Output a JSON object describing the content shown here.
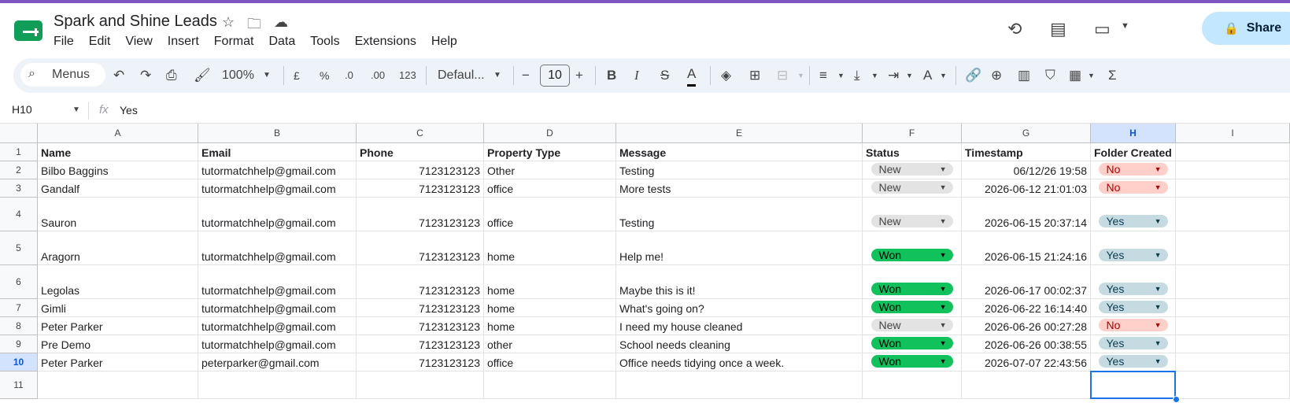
{
  "header": {
    "title": "Spark and Shine Leads",
    "menus": [
      "File",
      "Edit",
      "View",
      "Insert",
      "Format",
      "Data",
      "Tools",
      "Extensions",
      "Help"
    ],
    "share_label": "Share",
    "icons": [
      "star-icon",
      "move-to-folder-icon",
      "cloud-saved-icon",
      "history-icon",
      "comment-icon",
      "meet-icon"
    ]
  },
  "toolbar": {
    "search_label": "Menus",
    "zoom": "100%",
    "currency": "£",
    "percent": "%",
    "dec_decrease": ".0",
    "dec_increase": ".00",
    "number_format": "123",
    "font": "Defaul...",
    "font_size": "10",
    "bold": "B",
    "italic": "I",
    "strike": "S",
    "text_color": "A"
  },
  "formula_bar": {
    "cell_ref": "H10",
    "fx": "fx",
    "value": "Yes"
  },
  "columns": [
    "A",
    "B",
    "C",
    "D",
    "E",
    "F",
    "G",
    "H",
    "I"
  ],
  "rows": [
    "1",
    "2",
    "3",
    "4",
    "5",
    "6",
    "7",
    "8",
    "9",
    "10",
    "11"
  ],
  "table": {
    "headers": [
      "Name",
      "Email",
      "Phone",
      "Property Type",
      "Message",
      "Status",
      "Timestamp",
      "Folder Created"
    ],
    "data": [
      [
        "Bilbo Baggins",
        "tutormatchhelp@gmail.com",
        "7123123123",
        "Other",
        "Testing",
        "New",
        "06/12/26 19:58",
        "No"
      ],
      [
        "Gandalf",
        "tutormatchhelp@gmail.com",
        "7123123123",
        "office",
        "More tests",
        "New",
        "2026-06-12 21:01:03",
        "No"
      ],
      [
        "Sauron",
        "tutormatchhelp@gmail.com",
        "7123123123",
        "office",
        "Testing",
        "New",
        "2026-06-15 20:37:14",
        "Yes"
      ],
      [
        "Aragorn",
        "tutormatchhelp@gmail.com",
        "7123123123",
        "home",
        "Help me!",
        "Won",
        "2026-06-15 21:24:16",
        "Yes"
      ],
      [
        "Legolas",
        "tutormatchhelp@gmail.com",
        "7123123123",
        "home",
        "Maybe this is it!",
        "Won",
        "2026-06-17 00:02:37",
        "Yes"
      ],
      [
        "Gimli",
        "tutormatchhelp@gmail.com",
        "7123123123",
        "home",
        "What's going on?",
        "Won",
        "2026-06-22 16:14:40",
        "Yes"
      ],
      [
        "Peter Parker",
        "tutormatchhelp@gmail.com",
        "7123123123",
        "home",
        "I need my house cleaned",
        "New",
        "2026-06-26 00:27:28",
        "No"
      ],
      [
        "Pre Demo",
        "tutormatchhelp@gmail.com",
        "7123123123",
        "other",
        "School needs cleaning",
        "Won",
        "2026-06-26 00:38:55",
        "Yes"
      ],
      [
        "Peter Parker",
        "peterparker@gmail.com",
        "7123123123",
        "office",
        "Office needs tidying once a week.",
        "Won",
        "2026-07-07 22:43:56",
        "Yes"
      ]
    ]
  },
  "colors": {
    "status_new": "#e3e3e3",
    "status_won": "#11c15b",
    "folder_no": "#ffcfc9",
    "folder_yes": "#c6dbe1",
    "accent": "#1a73e8"
  }
}
